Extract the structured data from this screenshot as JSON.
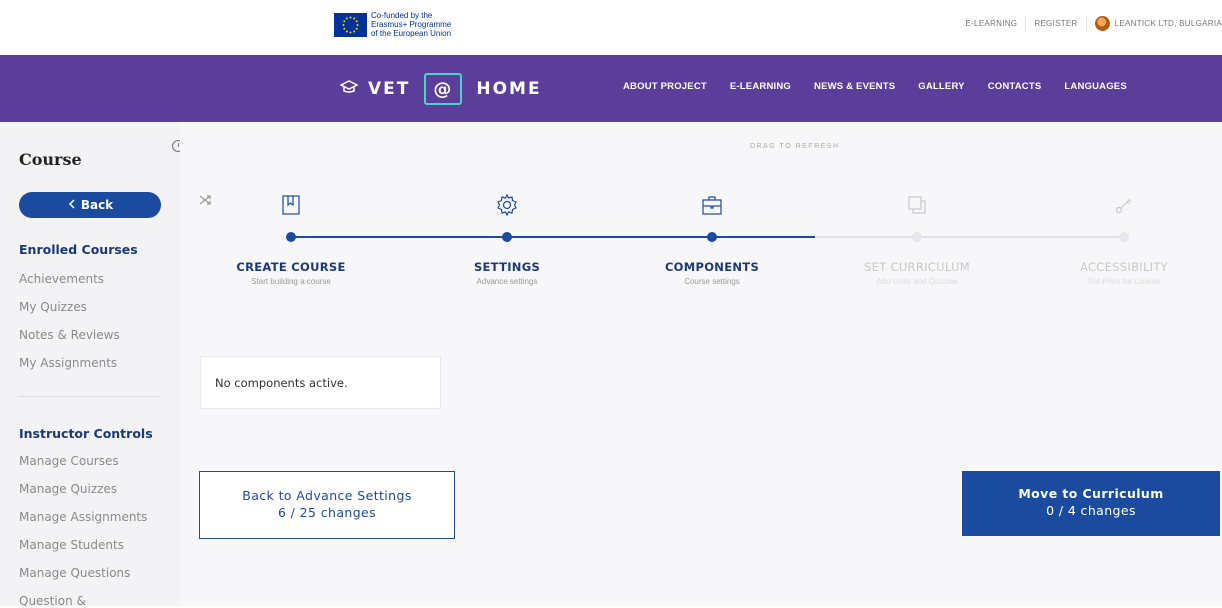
{
  "topbar": {
    "eu_lines": [
      "Co-funded by the",
      "Erasmus+ Programme",
      "of the European Union"
    ],
    "links": [
      "E-LEARNING",
      "REGISTER"
    ],
    "user": "LEANTICK LTD, BULGARIA"
  },
  "navbar": {
    "brand_left": "VET",
    "brand_at": "@",
    "brand_right": "HOME",
    "links": [
      "ABOUT PROJECT",
      "E-LEARNING",
      "NEWS & EVENTS",
      "GALLERY",
      "CONTACTS",
      "LANGUAGES"
    ]
  },
  "sidebar": {
    "title": "Course",
    "back_label": "Back",
    "enrolled_heading": "Enrolled Courses",
    "enrolled_items": [
      "Achievements",
      "My Quizzes",
      "Notes & Reviews",
      "My Assignments"
    ],
    "instructor_heading": "Instructor Controls",
    "instructor_items": [
      "Manage Courses",
      "Manage Quizzes",
      "Manage Assignments",
      "Manage Students",
      "Manage Questions",
      "Question &"
    ]
  },
  "main": {
    "drag_text": "DRAG TO REFRESH",
    "steps": [
      {
        "label": "CREATE COURSE",
        "sub": "Start building a course",
        "icon": "bookmark-icon",
        "state": "done"
      },
      {
        "label": "SETTINGS",
        "sub": "Advance settings",
        "icon": "gear-icon",
        "state": "done"
      },
      {
        "label": "COMPONENTS",
        "sub": "Course settings",
        "icon": "briefcase-icon",
        "state": "active"
      },
      {
        "label": "SET CURRICULUM",
        "sub": "Add Units and Quizzes",
        "icon": "copy-icon",
        "state": "pending"
      },
      {
        "label": "ACCESSIBILITY",
        "sub": "Set Price for Course",
        "icon": "key-icon",
        "state": "pending"
      }
    ],
    "no_components": "No components active.",
    "back_button": {
      "line1": "Back to Advance Settings",
      "line2": "6 / 25 changes"
    },
    "move_button": {
      "line1": "Move to Curriculum",
      "line2": "0 / 4 changes"
    }
  },
  "colors": {
    "nav_bg": "#5b3e99",
    "primary": "#1b4b9e",
    "sidebar_bg": "#f3f3f6"
  }
}
